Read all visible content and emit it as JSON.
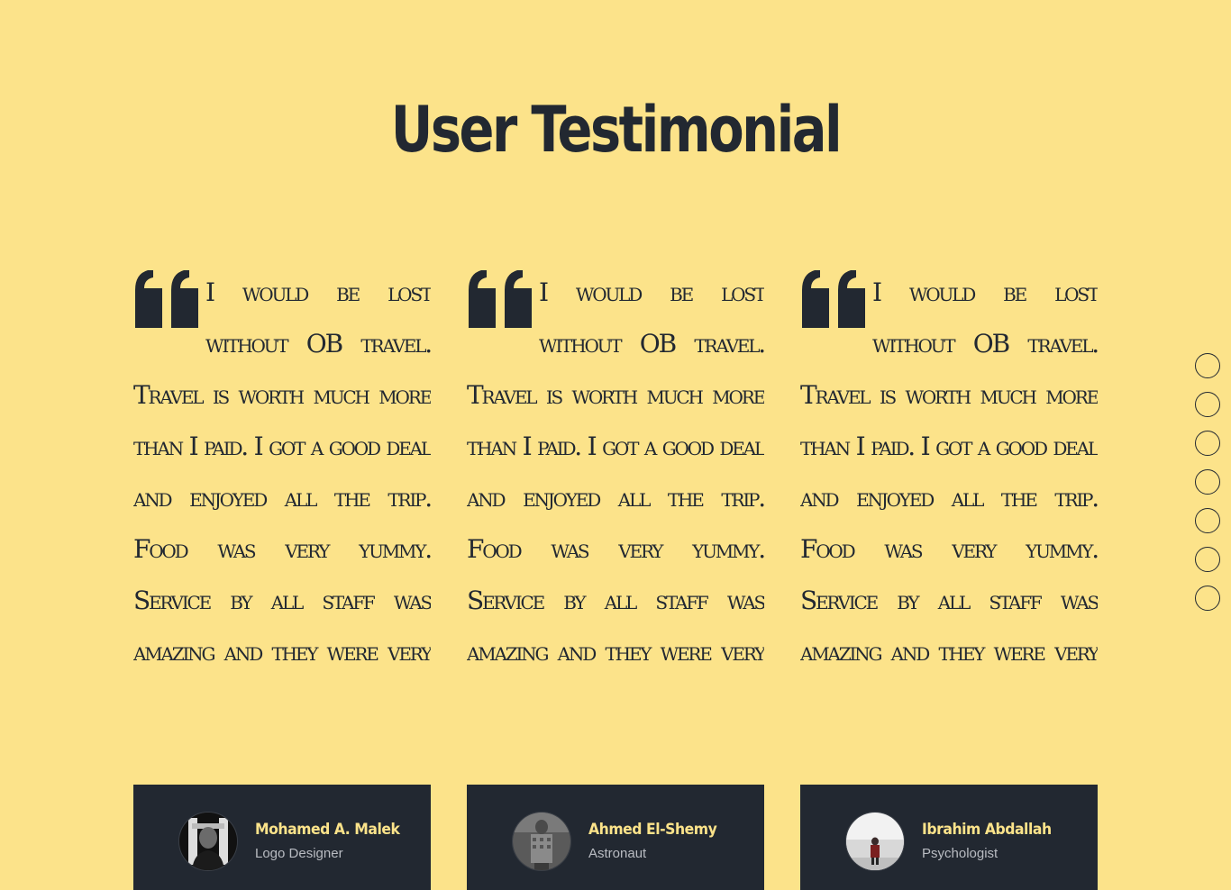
{
  "section": {
    "title": "User Testimonial"
  },
  "testimonials": [
    {
      "text": "I would be lost without OB travel. Travel is worth much more than I paid. I got a good deal and enjoyed all the trip. Food was very yummy. Service by all staff was amazing and they were very friendly and polite. Overall enjoyed alot!!",
      "author": "Mohamed A. Malek",
      "role": "Logo Designer"
    },
    {
      "text": "I would be lost without OB travel. Travel is worth much more than I paid. I got a good deal and enjoyed all the trip. Food was very yummy. Service by all staff was amazing and they were very friendly and polite. Overall enjoyed alot!!",
      "author": "Ahmed El-Shemy",
      "role": "Astronaut"
    },
    {
      "text": "I would be lost without OB travel. Travel is worth much more than I paid. I got a good deal and enjoyed all the trip. Food was very yummy. Service by all staff was amazing and they were very friendly and polite. Overall enjoyed alot!!",
      "author": "Ibrahim Abdallah",
      "role": "Psychologist"
    }
  ],
  "navigation_dots": 7,
  "colors": {
    "background": "#fce38a",
    "dark": "#222831",
    "accent": "#fce38a"
  },
  "icons": {
    "quote": "quote-icon",
    "dot": "nav-dot-icon"
  }
}
